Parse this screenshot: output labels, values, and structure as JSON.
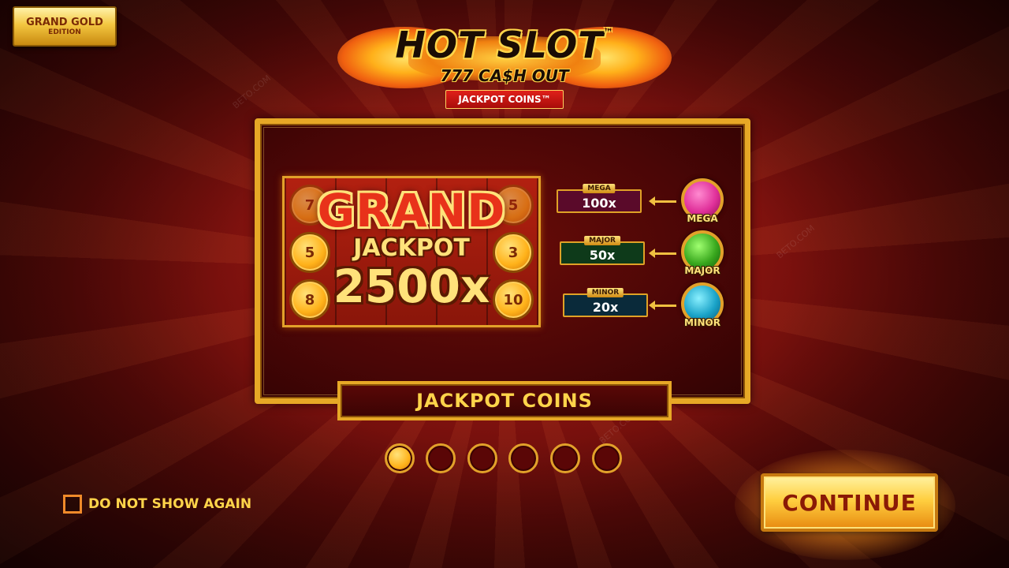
{
  "edition": {
    "line1": "GRAND GOLD",
    "line2": "EDITION"
  },
  "logo": {
    "title": "HOT SLOT",
    "trademark": "™",
    "subtitle": "777 CA$H OUT",
    "tag": "JACKPOT COINS™"
  },
  "reel": {
    "left_coins": [
      "7",
      "5",
      "8"
    ],
    "right_coins": [
      "5",
      "3",
      "10"
    ],
    "grand": "GRAND",
    "jackpot": "JACKPOT",
    "multiplier": "2500x"
  },
  "tiers": [
    {
      "name": "MEGA",
      "value": "100x",
      "color": "#e0309a"
    },
    {
      "name": "MAJOR",
      "value": "50x",
      "color": "#39a81e"
    },
    {
      "name": "MINOR",
      "value": "20x",
      "color": "#1aa3c8"
    }
  ],
  "page_title": "JACKPOT COINS",
  "pagination": {
    "total": 6,
    "current": 1
  },
  "do_not_show_again": "DO NOT SHOW AGAIN",
  "continue_label": "CONTINUE",
  "watermark": "BETO.COM"
}
